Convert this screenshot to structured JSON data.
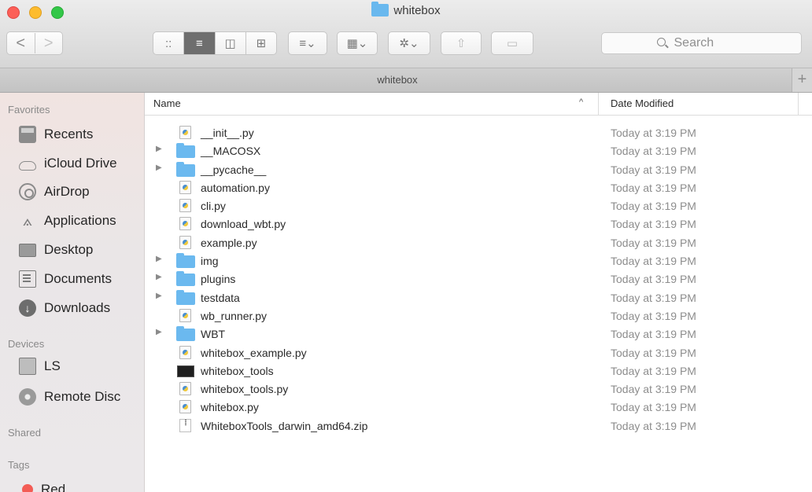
{
  "window": {
    "title": "whitebox",
    "accent_folder_color": "#69b8ee"
  },
  "toolbar": {
    "back_label": "<",
    "forward_label": ">",
    "view_icon_glyph": "::",
    "view_list_glyph": "≡",
    "view_column_glyph": "◫",
    "view_cover_glyph": "⊞",
    "arrange_glyph": "≡⌄",
    "group_glyph": "▦⌄",
    "action_glyph": "✲⌄",
    "share_glyph": "⇧",
    "tag_glyph": "▭",
    "search_placeholder": "Search"
  },
  "tab": {
    "label": "whitebox",
    "add_label": "+"
  },
  "sidebar": {
    "favorites_heading": "Favorites",
    "favorites": [
      {
        "label": "Recents",
        "icon": "clock-icon"
      },
      {
        "label": "iCloud Drive",
        "icon": "cloud-icon"
      },
      {
        "label": "AirDrop",
        "icon": "airdrop-icon"
      },
      {
        "label": "Applications",
        "icon": "applications-icon"
      },
      {
        "label": "Desktop",
        "icon": "desktop-icon"
      },
      {
        "label": "Documents",
        "icon": "documents-icon"
      },
      {
        "label": "Downloads",
        "icon": "downloads-icon"
      }
    ],
    "devices_heading": "Devices",
    "devices": [
      {
        "label": "LS",
        "icon": "drive-icon"
      },
      {
        "label": "Remote Disc",
        "icon": "disc-icon"
      }
    ],
    "shared_heading": "Shared",
    "tags_heading": "Tags",
    "tags": [
      {
        "label": "Red",
        "color": "#f35c55"
      }
    ]
  },
  "columns": {
    "name": "Name",
    "date_modified": "Date Modified",
    "sort_indicator": "^"
  },
  "files": [
    {
      "name": "__init__.py",
      "date": "Today at 3:19 PM",
      "kind": "py",
      "expandable": false
    },
    {
      "name": "__MACOSX",
      "date": "Today at 3:19 PM",
      "kind": "folder",
      "expandable": true
    },
    {
      "name": "__pycache__",
      "date": "Today at 3:19 PM",
      "kind": "folder",
      "expandable": true
    },
    {
      "name": "automation.py",
      "date": "Today at 3:19 PM",
      "kind": "py",
      "expandable": false
    },
    {
      "name": "cli.py",
      "date": "Today at 3:19 PM",
      "kind": "py",
      "expandable": false
    },
    {
      "name": "download_wbt.py",
      "date": "Today at 3:19 PM",
      "kind": "py",
      "expandable": false
    },
    {
      "name": "example.py",
      "date": "Today at 3:19 PM",
      "kind": "py",
      "expandable": false
    },
    {
      "name": "img",
      "date": "Today at 3:19 PM",
      "kind": "folder",
      "expandable": true
    },
    {
      "name": "plugins",
      "date": "Today at 3:19 PM",
      "kind": "folder",
      "expandable": true
    },
    {
      "name": "testdata",
      "date": "Today at 3:19 PM",
      "kind": "folder",
      "expandable": true
    },
    {
      "name": "wb_runner.py",
      "date": "Today at 3:19 PM",
      "kind": "py",
      "expandable": false
    },
    {
      "name": "WBT",
      "date": "Today at 3:19 PM",
      "kind": "folder",
      "expandable": true
    },
    {
      "name": "whitebox_example.py",
      "date": "Today at 3:19 PM",
      "kind": "py",
      "expandable": false
    },
    {
      "name": "whitebox_tools",
      "date": "Today at 3:19 PM",
      "kind": "exec",
      "expandable": false
    },
    {
      "name": "whitebox_tools.py",
      "date": "Today at 3:19 PM",
      "kind": "py",
      "expandable": false
    },
    {
      "name": "whitebox.py",
      "date": "Today at 3:19 PM",
      "kind": "py",
      "expandable": false
    },
    {
      "name": "WhiteboxTools_darwin_amd64.zip",
      "date": "Today at 3:19 PM",
      "kind": "zip",
      "expandable": false
    }
  ]
}
